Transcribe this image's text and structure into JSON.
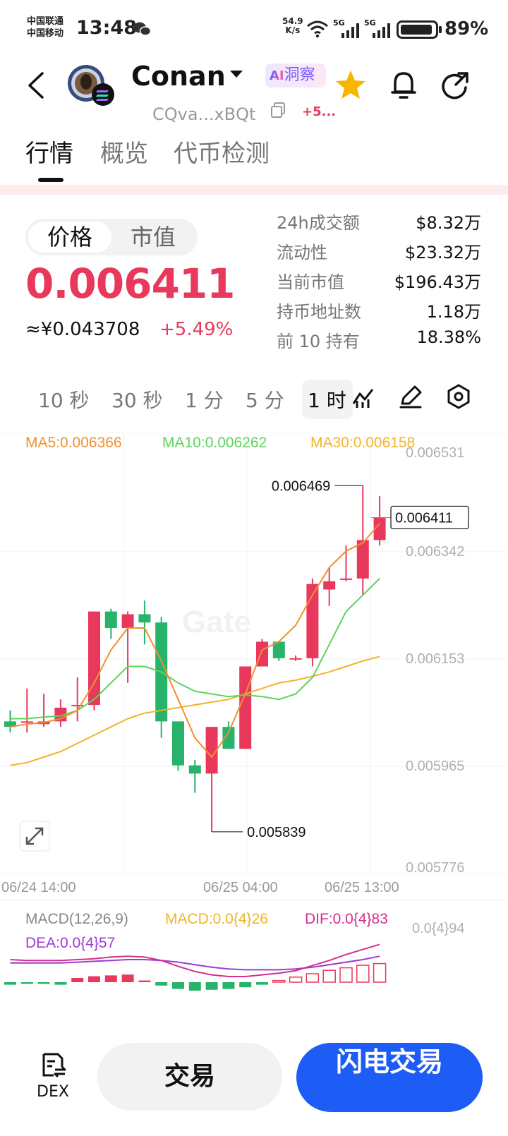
{
  "status_bar": {
    "carrier1": "中国联通",
    "carrier2": "中国移动",
    "time": "13:48",
    "net_speed_value": "54.9",
    "net_speed_unit": "K/s",
    "signal1": "5G",
    "signal2": "5G",
    "battery": "89%"
  },
  "header": {
    "coin_name": "Conan",
    "ai_badge": "洞察",
    "ai_prefix": "AI",
    "address": "CQva...xBQt",
    "change_short": "+5..."
  },
  "tabs": [
    "行情",
    "概览",
    "代币检测"
  ],
  "price_panel": {
    "toggle": [
      "价格",
      "市值"
    ],
    "price": "0.006411",
    "cny_price": "≈¥0.043708",
    "change_pct": "+5.49%"
  },
  "stats": [
    {
      "label": "24h成交额",
      "value": "$8.32万"
    },
    {
      "label": "流动性",
      "value": "$23.32万"
    },
    {
      "label": "当前市值",
      "value": "$196.43万"
    },
    {
      "label": "持币地址数",
      "value": "1.18万"
    },
    {
      "label": "前 10 持有",
      "value": "18.38%"
    }
  ],
  "intervals": [
    "10 秒",
    "30 秒",
    "1 分",
    "5 分",
    "1 时"
  ],
  "chart_data": {
    "type": "candlestick",
    "ma": {
      "ma5": "MA5:0.006366",
      "ma10": "MA10:0.006262",
      "ma30": "MA30:0.006158"
    },
    "y_ticks": [
      "0.006531",
      "0.006342",
      "0.006153",
      "0.005965",
      "0.005776"
    ],
    "x_ticks": [
      "06/24 14:00",
      "06/25 04:00",
      "06/25 13:00"
    ],
    "high_label": "0.006469",
    "low_label": "0.005839",
    "last_label": "0.006411",
    "watermark": "Gate",
    "colors": {
      "up": "#e8385b",
      "down": "#27b36a",
      "ma5": "#f0902f",
      "ma10": "#5dd35d",
      "ma30": "#f2b32a"
    },
    "candles": [
      {
        "o": 0.00604,
        "h": 0.00606,
        "l": 0.00602,
        "c": 0.00603
      },
      {
        "o": 0.00604,
        "h": 0.0061,
        "l": 0.00602,
        "c": 0.00604
      },
      {
        "o": 0.006035,
        "h": 0.00609,
        "l": 0.00603,
        "c": 0.00604
      },
      {
        "o": 0.00604,
        "h": 0.00608,
        "l": 0.00603,
        "c": 0.006065
      },
      {
        "o": 0.00607,
        "h": 0.00612,
        "l": 0.00604,
        "c": 0.00607
      },
      {
        "o": 0.00607,
        "h": 0.00624,
        "l": 0.00606,
        "c": 0.00624
      },
      {
        "o": 0.00624,
        "h": 0.006245,
        "l": 0.00619,
        "c": 0.00621
      },
      {
        "o": 0.00621,
        "h": 0.00624,
        "l": 0.00611,
        "c": 0.006235
      },
      {
        "o": 0.006235,
        "h": 0.00626,
        "l": 0.00618,
        "c": 0.00622
      },
      {
        "o": 0.00622,
        "h": 0.00623,
        "l": 0.00601,
        "c": 0.00604
      },
      {
        "o": 0.00604,
        "h": 0.00604,
        "l": 0.00595,
        "c": 0.00596
      },
      {
        "o": 0.00596,
        "h": 0.00597,
        "l": 0.00591,
        "c": 0.005945
      },
      {
        "o": 0.005945,
        "h": 0.00603,
        "l": 0.005839,
        "c": 0.00603
      },
      {
        "o": 0.00603,
        "h": 0.00604,
        "l": 0.00599,
        "c": 0.00599
      },
      {
        "o": 0.00599,
        "h": 0.00614,
        "l": 0.00599,
        "c": 0.00614
      },
      {
        "o": 0.00614,
        "h": 0.00619,
        "l": 0.00614,
        "c": 0.006185
      },
      {
        "o": 0.006185,
        "h": 0.006185,
        "l": 0.00615,
        "c": 0.006155
      },
      {
        "o": 0.006155,
        "h": 0.00616,
        "l": 0.00615,
        "c": 0.006155
      },
      {
        "o": 0.006155,
        "h": 0.0063,
        "l": 0.00614,
        "c": 0.00629
      },
      {
        "o": 0.00628,
        "h": 0.00632,
        "l": 0.00625,
        "c": 0.006295
      },
      {
        "o": 0.0063,
        "h": 0.00636,
        "l": 0.006295,
        "c": 0.0063
      },
      {
        "o": 0.0063,
        "h": 0.006469,
        "l": 0.00627,
        "c": 0.00637
      },
      {
        "o": 0.00637,
        "h": 0.00645,
        "l": 0.00636,
        "c": 0.006411
      }
    ],
    "ma5_series": [
      0.00603,
      0.006035,
      0.006038,
      0.006045,
      0.00606,
      0.00611,
      0.00617,
      0.00621,
      0.00621,
      0.00615,
      0.00608,
      0.00601,
      0.005975,
      0.00602,
      0.00609,
      0.00617,
      0.006185,
      0.006215,
      0.00627,
      0.00632,
      0.00635,
      0.006365,
      0.0064
    ],
    "ma10_series": [
      0.006045,
      0.006045,
      0.006048,
      0.00605,
      0.00606,
      0.00608,
      0.00611,
      0.00614,
      0.00614,
      0.00613,
      0.00611,
      0.006095,
      0.00609,
      0.006085,
      0.006088,
      0.006085,
      0.00608,
      0.00609,
      0.00612,
      0.00618,
      0.00624,
      0.00627,
      0.0063
    ],
    "ma30_series": [
      0.00596,
      0.005965,
      0.005975,
      0.005985,
      0.006,
      0.006015,
      0.00603,
      0.006045,
      0.006055,
      0.00606,
      0.006065,
      0.00607,
      0.006075,
      0.00608,
      0.00609,
      0.0061,
      0.00611,
      0.006115,
      0.006122,
      0.00613,
      0.00614,
      0.00615,
      0.006158
    ]
  },
  "macd": {
    "params": "MACD(12,26,9)",
    "macd": "MACD:0.0{4}26",
    "dif": "DIF:0.0{4}83",
    "dea": "DEA:0.0{4}57",
    "axis_label": "0.0{4}94",
    "bars": [
      -0.3,
      -0.2,
      -0.2,
      -0.3,
      0.5,
      0.7,
      0.8,
      0.9,
      0.2,
      -0.4,
      -0.8,
      -1.0,
      -0.9,
      -0.8,
      -0.6,
      -0.3,
      0.2,
      0.6,
      1.0,
      1.4,
      1.7,
      2.0,
      2.2
    ],
    "dif_series": [
      2.0,
      1.9,
      1.9,
      1.9,
      2.0,
      2.1,
      2.3,
      2.4,
      2.3,
      1.9,
      1.2,
      0.6,
      0.2,
      0.0,
      0.0,
      0.2,
      0.4,
      0.7,
      1.3,
      1.9,
      2.6,
      3.2,
      3.8
    ],
    "dea_series": [
      1.6,
      1.6,
      1.6,
      1.6,
      1.7,
      1.8,
      1.9,
      2.0,
      2.0,
      1.9,
      1.7,
      1.4,
      1.1,
      0.9,
      0.8,
      0.8,
      0.8,
      0.9,
      1.1,
      1.4,
      1.7,
      2.0,
      2.4
    ]
  },
  "bottom_bar": {
    "dex": "DEX",
    "trade": "交易",
    "flash_trade": "闪电交易"
  }
}
